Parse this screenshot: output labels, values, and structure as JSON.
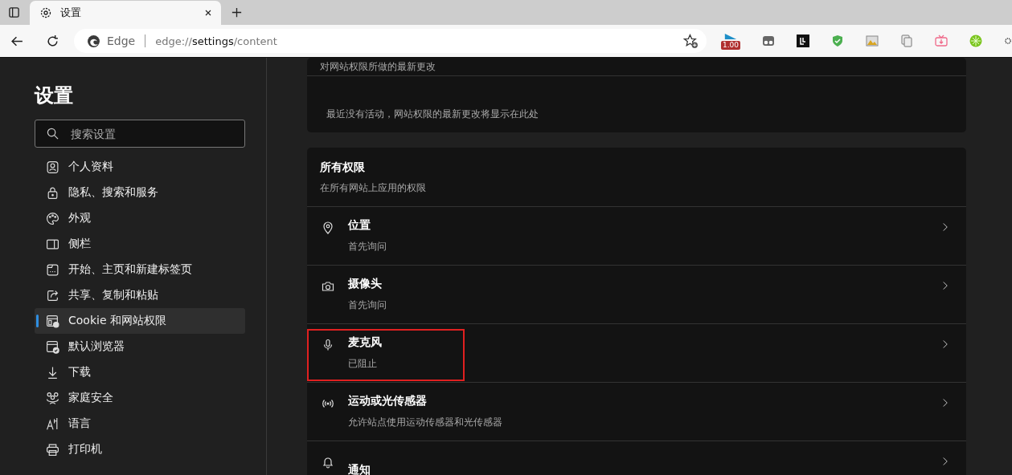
{
  "tab": {
    "title": "设置"
  },
  "address_bar": {
    "site_label": "Edge",
    "url_prefix": "edge://",
    "url_host": "settings",
    "url_path": "/content"
  },
  "extension_badge": "1.00",
  "sidebar": {
    "title": "设置",
    "search": {
      "placeholder": "搜索设置"
    },
    "items": [
      {
        "label": "个人资料",
        "selected": false
      },
      {
        "label": "隐私、搜索和服务",
        "selected": false
      },
      {
        "label": "外观",
        "selected": false
      },
      {
        "label": "侧栏",
        "selected": false
      },
      {
        "label": "开始、主页和新建标签页",
        "selected": false
      },
      {
        "label": "共享、复制和粘贴",
        "selected": false
      },
      {
        "label": "Cookie 和网站权限",
        "selected": true
      },
      {
        "label": "默认浏览器",
        "selected": false
      },
      {
        "label": "下载",
        "selected": false
      },
      {
        "label": "家庭安全",
        "selected": false
      },
      {
        "label": "语言",
        "selected": false
      },
      {
        "label": "打印机",
        "selected": false
      }
    ]
  },
  "recent_activity": {
    "subtitle": "对网站权限所做的最新更改",
    "empty_message": "最近没有活动，网站权限的最新更改将显示在此处"
  },
  "all_permissions": {
    "title": "所有权限",
    "subtitle": "在所有网站上应用的权限",
    "items": [
      {
        "title": "位置",
        "status": "首先询问",
        "highlighted": false
      },
      {
        "title": "摄像头",
        "status": "首先询问",
        "highlighted": false
      },
      {
        "title": "麦克风",
        "status": "已阻止",
        "highlighted": true
      },
      {
        "title": "运动或光传感器",
        "status": "允许站点使用运动传感器和光传感器",
        "highlighted": false
      },
      {
        "title": "通知",
        "highlighted": false
      }
    ]
  }
}
